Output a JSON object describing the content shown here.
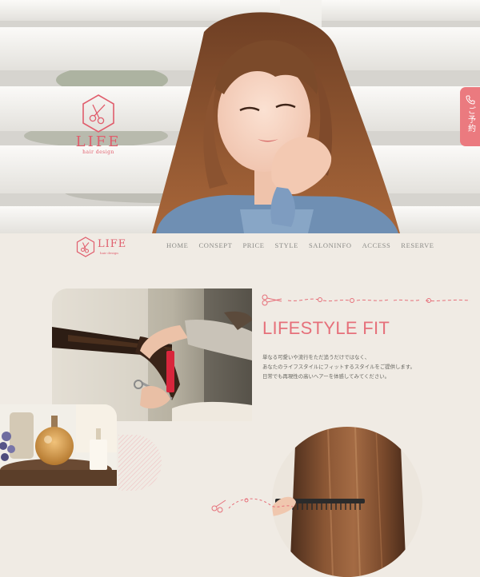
{
  "hero": {
    "logo": {
      "brand": "LIFE",
      "tagline": "hair design"
    },
    "reserve_tab": {
      "label": "ご予約"
    }
  },
  "nav": {
    "logo": {
      "brand": "LIFE",
      "tagline": "hair design"
    },
    "items": [
      "HOME",
      "CONSEPT",
      "PRICE",
      "STYLE",
      "SALONINFO",
      "ACCESS",
      "RESERVE"
    ]
  },
  "section": {
    "title": "LIFESTYLE FIT",
    "lines": [
      "単なる可愛いや流行をただ追うだけではなく、",
      "あなたのライフスタイルにフィットするスタイルをご提供します。",
      "日常でも再現性の高いヘアーを体感してみてください。"
    ]
  },
  "colors": {
    "accent": "#e6707a",
    "brand": "#e05d6c",
    "background": "#f0ebe4",
    "reserve_tab": "#eb7a7f",
    "nav_text": "#8a8a86"
  }
}
